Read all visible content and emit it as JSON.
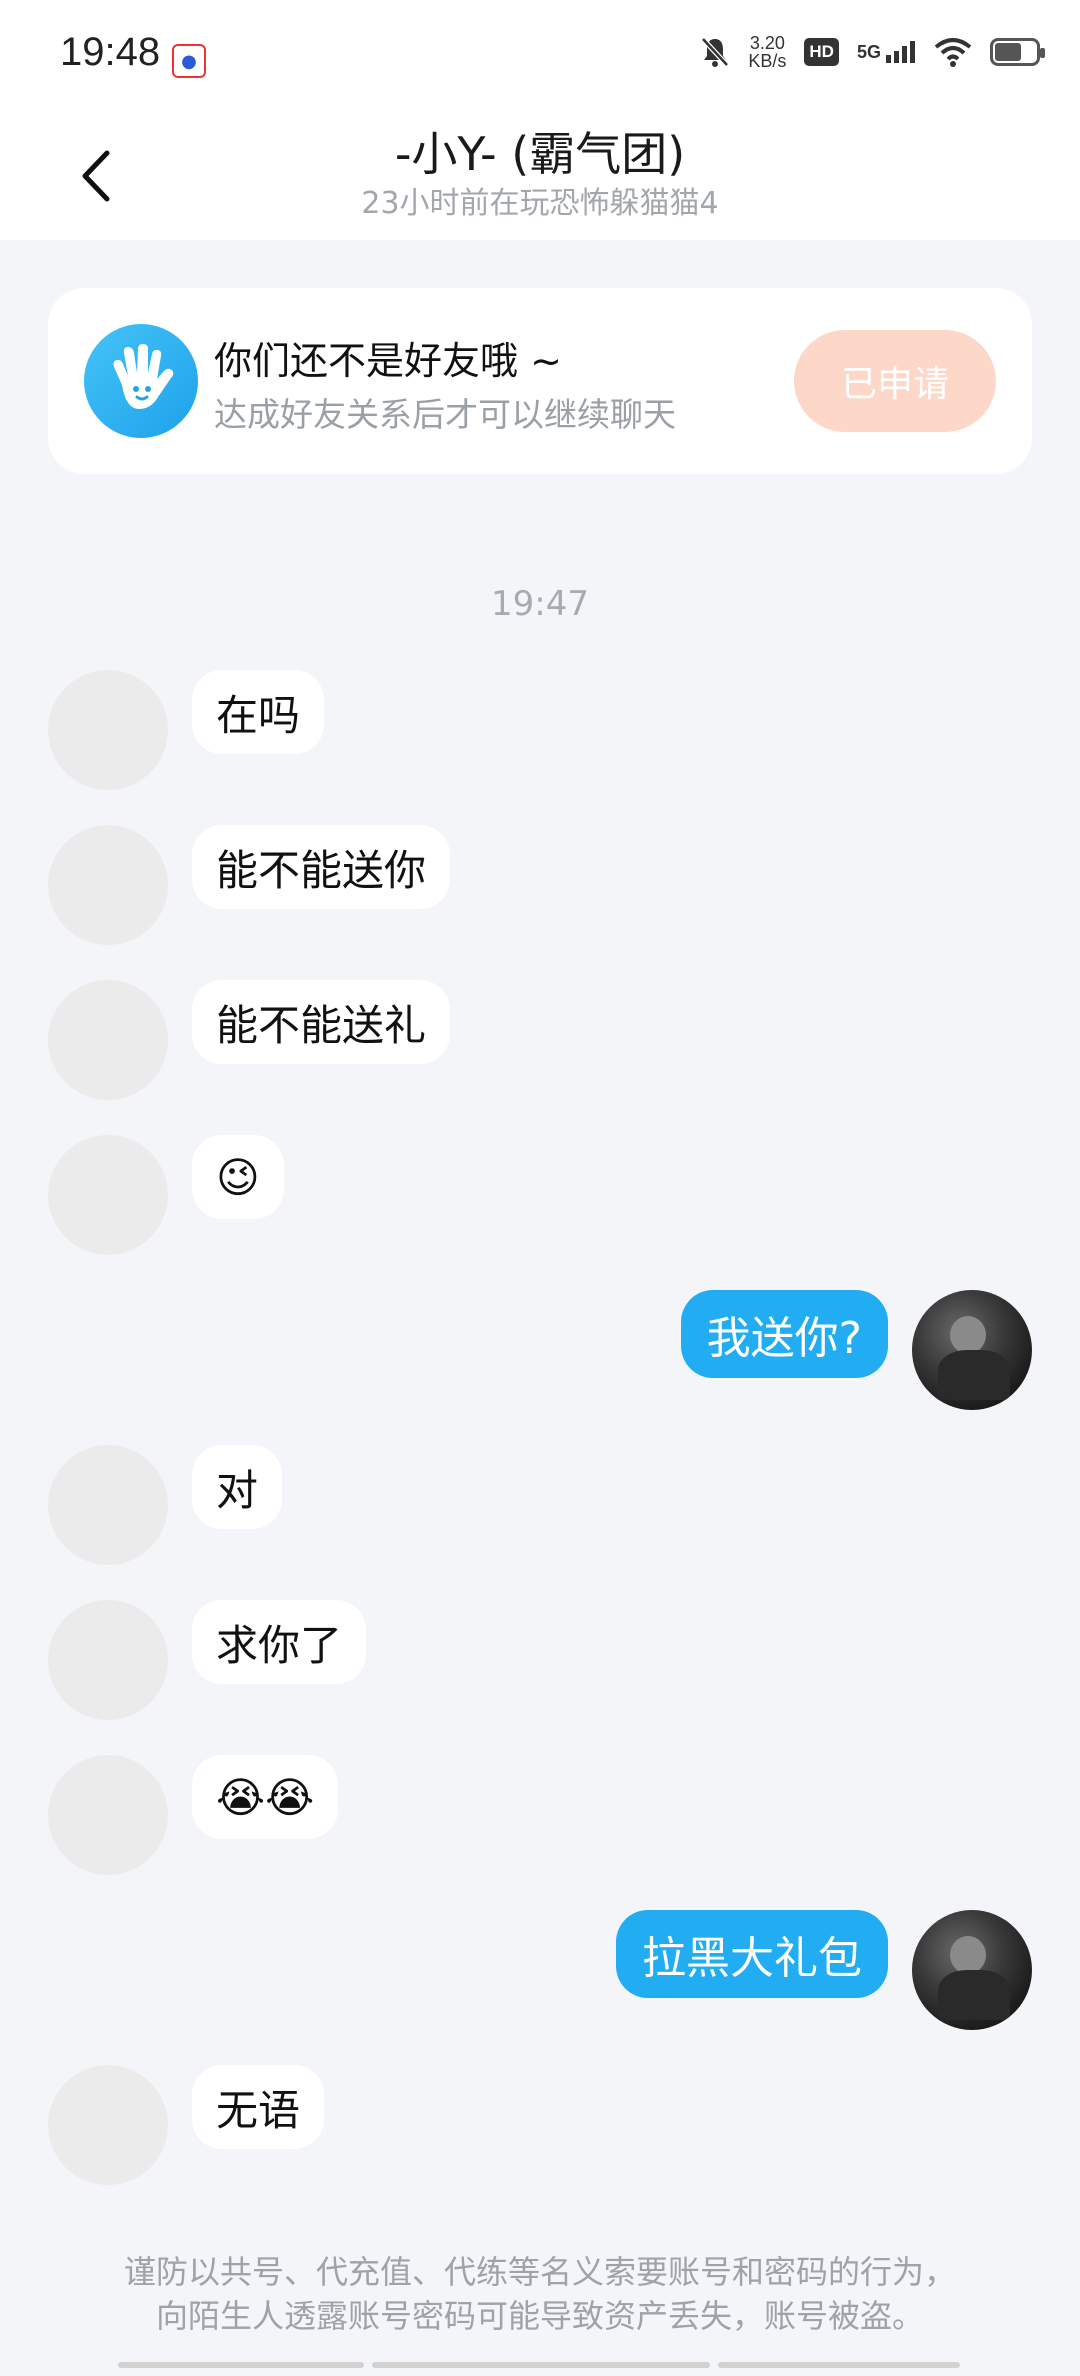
{
  "status": {
    "time": "19:48",
    "speed_value": "3.20",
    "speed_unit": "KB/s",
    "hd": "HD",
    "network": "5G"
  },
  "header": {
    "title": "-小Y- (霸气团)",
    "subtitle": "23小时前在玩恐怖躲猫猫4"
  },
  "friend_notice": {
    "title": "你们还不是好友哦 ~",
    "desc": "达成好友关系后才可以继续聊天",
    "button": "已申请"
  },
  "time_separator": "19:47",
  "messages": [
    {
      "side": "in",
      "text": "在吗"
    },
    {
      "side": "in",
      "text": "能不能送你"
    },
    {
      "side": "in",
      "text": "能不能送礼"
    },
    {
      "side": "in",
      "text": "😉"
    },
    {
      "side": "out",
      "text": "我送你?"
    },
    {
      "side": "in",
      "text": "对"
    },
    {
      "side": "in",
      "text": "求你了"
    },
    {
      "side": "in",
      "text": "😭😭"
    },
    {
      "side": "out",
      "text": "拉黑大礼包"
    },
    {
      "side": "in",
      "text": "无语"
    }
  ],
  "disclaimer": {
    "line1": "谨防以共号、代充值、代练等名义索要账号和密码的行为，",
    "line2": "向陌生人透露账号密码可能导致资产丢失，账号被盗。"
  }
}
